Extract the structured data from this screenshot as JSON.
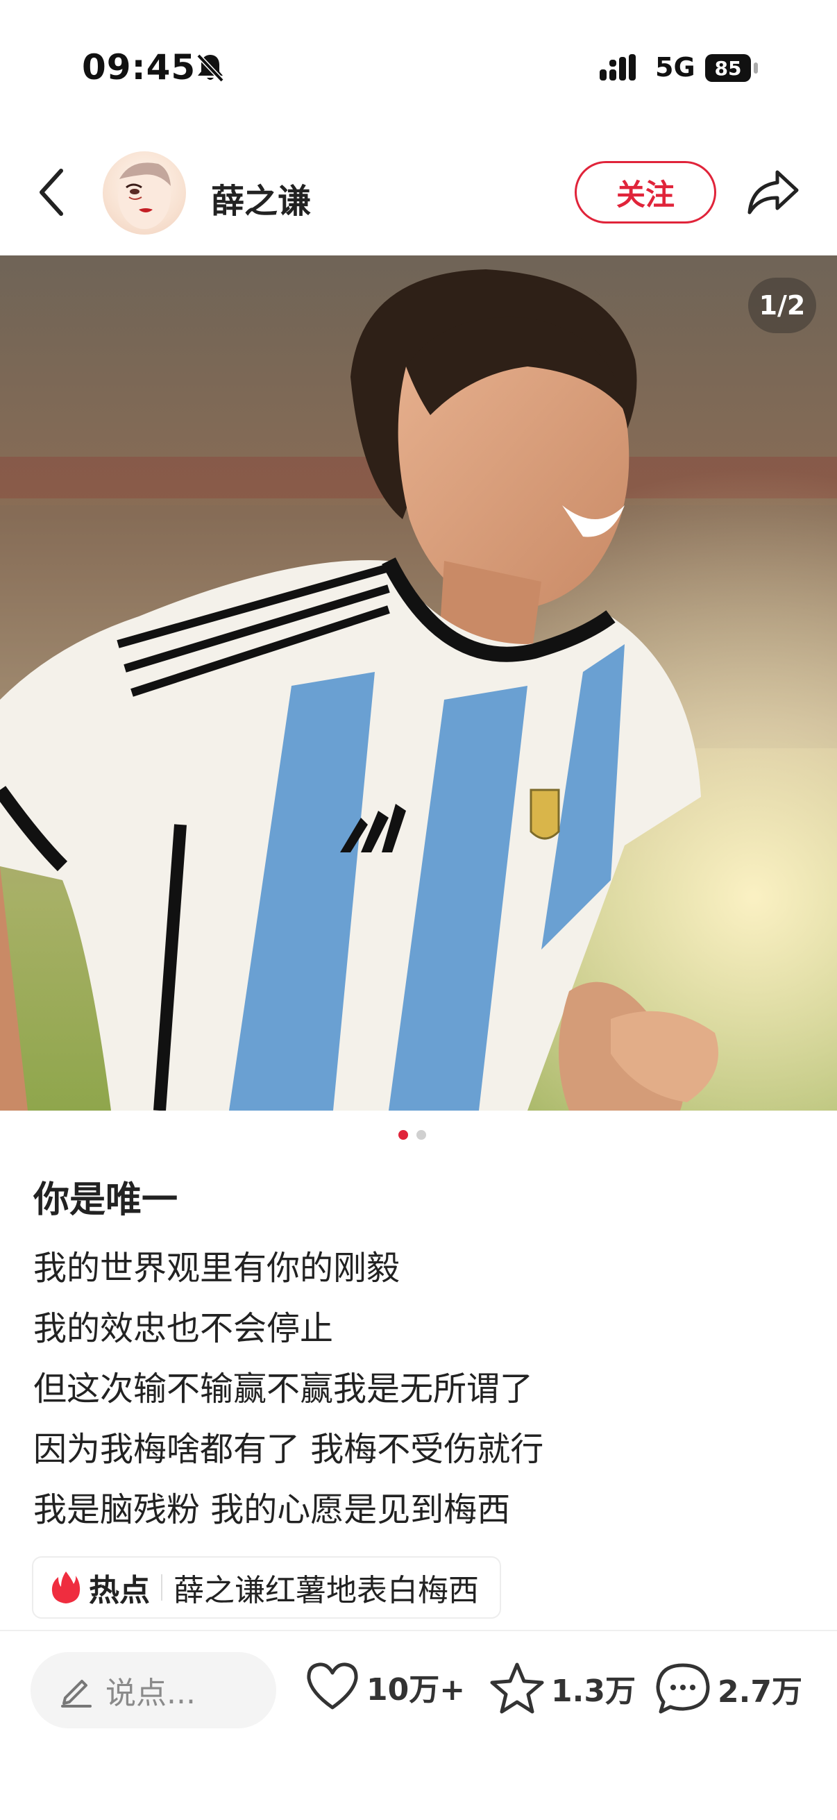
{
  "status_bar": {
    "time": "09:45",
    "network": "5G",
    "battery": "85",
    "icons": [
      "bell-slash-icon",
      "signal-icon"
    ]
  },
  "header": {
    "username": "薛之谦",
    "follow_label": "关注",
    "icons": [
      "chevron-left-icon",
      "share-icon"
    ]
  },
  "photo": {
    "page_indicator": "1/2",
    "dots": 2,
    "active_dot": 0
  },
  "post": {
    "title": "你是唯一",
    "lines": [
      "我的世界观里有你的刚毅",
      "我的效忠也不会停止",
      "但这次输不输赢不赢我是无所谓了",
      "因为我梅啥都有了 我梅不受伤就行",
      "我是脑残粉 我的心愿是见到梅西"
    ],
    "hot_tag": {
      "label": "热点",
      "topic": "薛之谦红薯地表白梅西"
    }
  },
  "bottom_bar": {
    "comment_placeholder": "说点...",
    "likes": "10万+",
    "favorites": "1.3万",
    "comments": "2.7万"
  },
  "colors": {
    "accent": "#e0243a",
    "text": "#222222"
  }
}
